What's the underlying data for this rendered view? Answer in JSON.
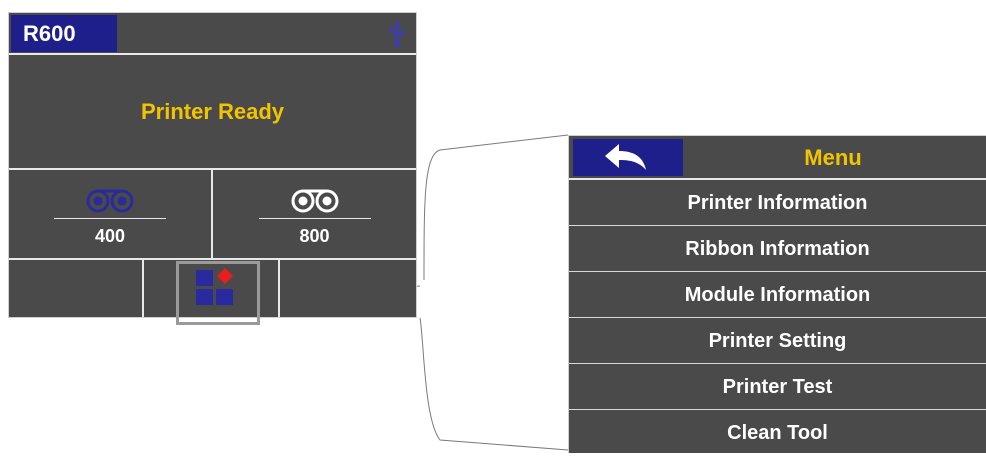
{
  "main_screen": {
    "model": "R600",
    "status": "Printer Ready",
    "usb_icon": "usb-icon",
    "ribbons": [
      {
        "icon": "ribbon-reel-icon",
        "color": "#2a2a9c",
        "value": "400"
      },
      {
        "icon": "ribbon-reel-icon",
        "color": "#ffffff",
        "value": "800"
      }
    ],
    "menu_icon": "menu-grid-icon"
  },
  "menu": {
    "title": "Menu",
    "back_icon": "back-arrow-icon",
    "items": [
      "Printer Information",
      "Ribbon Information",
      "Module Information",
      "Printer Setting",
      "Printer Test",
      "Clean Tool"
    ]
  },
  "colors": {
    "panel_bg": "#4a4a4a",
    "accent_blue": "#1f1f8c",
    "title_yellow": "#f2c400",
    "menu_icon_red": "#e81e1e"
  }
}
